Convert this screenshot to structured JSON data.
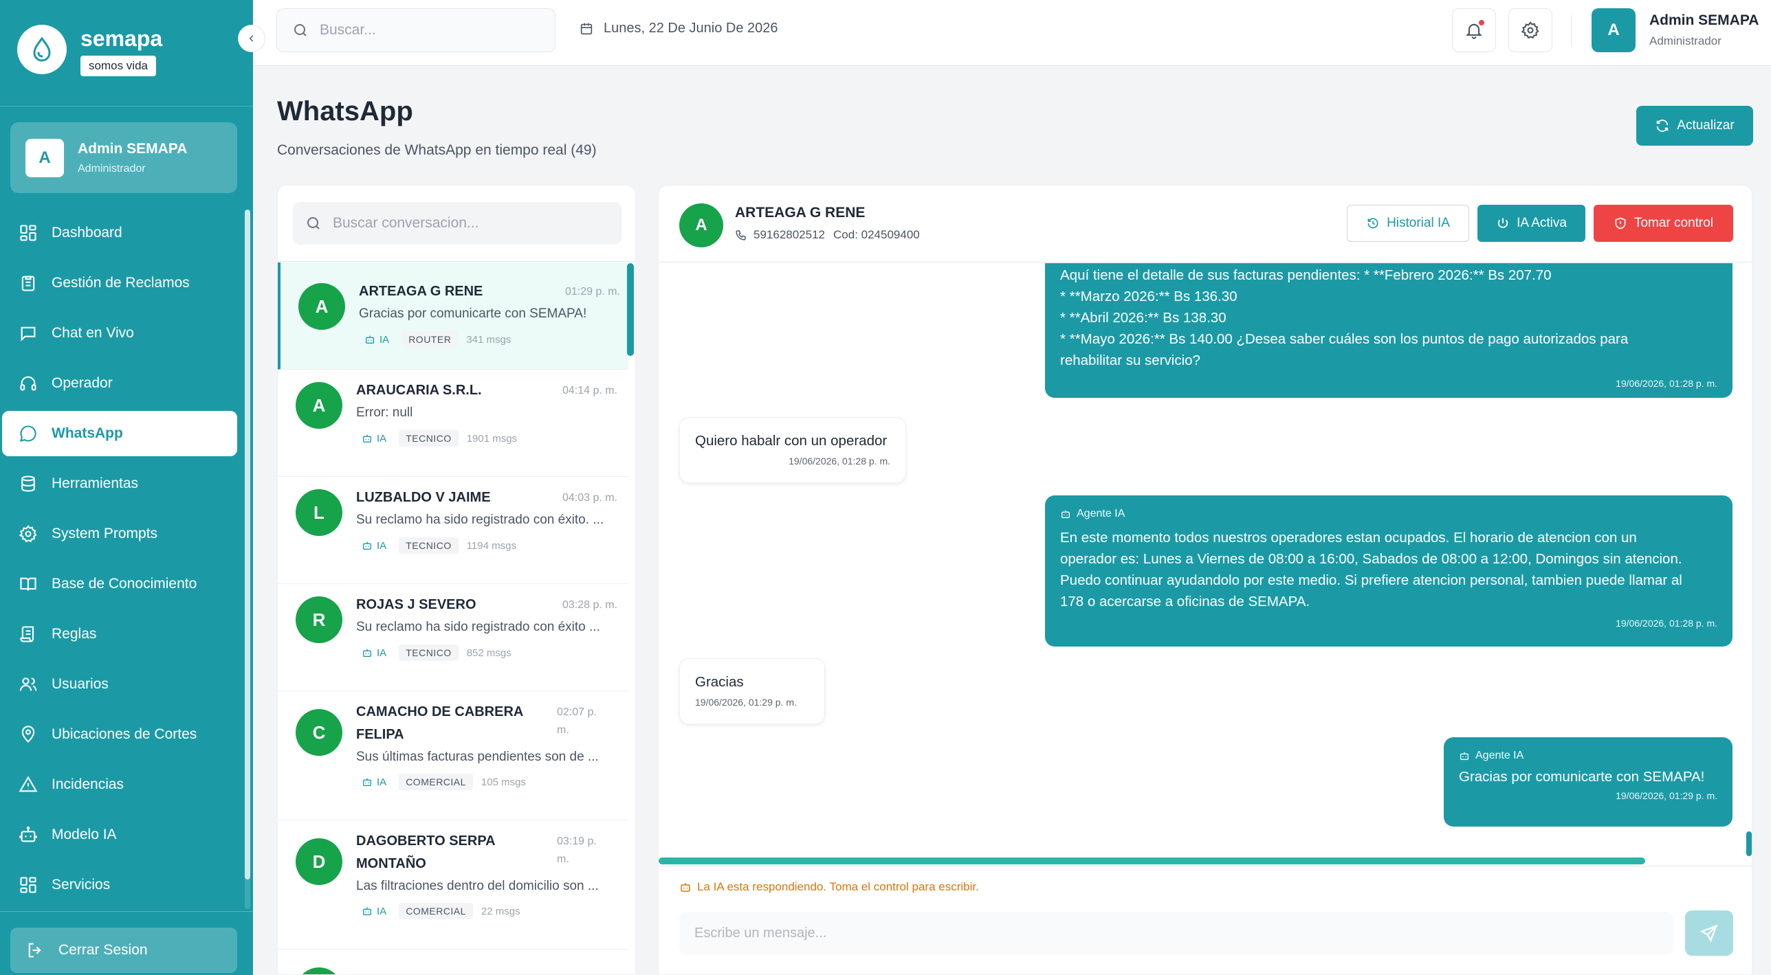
{
  "brand": {
    "name": "semapa",
    "tagline": "somos vida"
  },
  "sidebar_user": {
    "initial": "A",
    "name": "Admin SEMAPA",
    "role": "Administrador"
  },
  "nav": [
    {
      "label": "Dashboard",
      "icon": "dashboard-icon"
    },
    {
      "label": "Gestión de Reclamos",
      "icon": "clipboard-icon"
    },
    {
      "label": "Chat en Vivo",
      "icon": "chat-bubble-icon"
    },
    {
      "label": "Operador",
      "icon": "headphones-icon"
    },
    {
      "label": "WhatsApp",
      "icon": "whatsapp-icon",
      "active": true
    },
    {
      "label": "Herramientas",
      "icon": "database-icon"
    },
    {
      "label": "System Prompts",
      "icon": "gear-icon"
    },
    {
      "label": "Base de Conocimiento",
      "icon": "book-icon"
    },
    {
      "label": "Reglas",
      "icon": "scroll-icon"
    },
    {
      "label": "Usuarios",
      "icon": "users-icon"
    },
    {
      "label": "Ubicaciones de Cortes",
      "icon": "map-pin-icon"
    },
    {
      "label": "Incidencias",
      "icon": "warning-icon"
    },
    {
      "label": "Modelo IA",
      "icon": "robot-icon"
    },
    {
      "label": "Servicios",
      "icon": "grid-icon"
    }
  ],
  "logout_label": "Cerrar Sesion",
  "topbar": {
    "search_placeholder": "Buscar...",
    "date": "Lunes, 22 De Junio De 2026",
    "user_initial": "A",
    "user_name": "Admin SEMAPA",
    "user_role": "Administrador"
  },
  "page": {
    "title": "WhatsApp",
    "subtitle": "Conversaciones de WhatsApp en tiempo real (49)",
    "refresh_label": "Actualizar"
  },
  "conversation_search_placeholder": "Buscar conversacion...",
  "conversations": [
    {
      "initial": "A",
      "name": "ARTEAGA G RENE",
      "time": "01:29 p. m.",
      "preview": "Gracias por comunicarte con SEMAPA!",
      "ia": "IA",
      "category": "ROUTER",
      "count": "341 msgs"
    },
    {
      "initial": "A",
      "name": "ARAUCARIA S.R.L.",
      "time": "04:14 p. m.",
      "preview": "Error: null",
      "ia": "IA",
      "category": "TECNICO",
      "count": "1901 msgs"
    },
    {
      "initial": "L",
      "name": "LUZBALDO V JAIME",
      "time": "04:03 p. m.",
      "preview": "Su reclamo ha sido registrado con éxito. ...",
      "ia": "IA",
      "category": "TECNICO",
      "count": "1194 msgs"
    },
    {
      "initial": "R",
      "name": "ROJAS J SEVERO",
      "time": "03:28 p. m.",
      "preview": "Su reclamo ha sido registrado con éxito ...",
      "ia": "IA",
      "category": "TECNICO",
      "count": "852 msgs"
    },
    {
      "initial": "C",
      "name": "CAMACHO DE CABRERA FELIPA",
      "time": "02:07 p. m.",
      "preview": "Sus últimas facturas pendientes son de ...",
      "ia": "IA",
      "category": "COMERCIAL",
      "count": "105 msgs"
    },
    {
      "initial": "D",
      "name": "DAGOBERTO SERPA MONTAÑO",
      "time": "03:19 p. m.",
      "preview": "Las filtraciones dentro del domicilio son ...",
      "ia": "IA",
      "category": "COMERCIAL",
      "count": "22 msgs"
    }
  ],
  "chat": {
    "initial": "A",
    "name": "ARTEAGA G RENE",
    "phone": "59162802512",
    "code": "Cod: 024509400",
    "history_label": "Historial IA",
    "ia_active_label": "IA Activa",
    "take_control_label": "Tomar control",
    "messages": [
      {
        "direction": "out",
        "label": "",
        "lines": [
          "Aquí tiene el detalle de sus facturas pendientes: * **Febrero 2026:** Bs 207.70",
          "* **Marzo 2026:** Bs 136.30",
          "* **Abril 2026:** Bs 138.30",
          "* **Mayo 2026:** Bs 140.00 ¿Desea saber cuáles son los puntos de pago autorizados para",
          "rehabilitar su servicio?"
        ],
        "time": "19/06/2026, 01:28 p. m."
      },
      {
        "direction": "in",
        "lines": [
          "Quiero habalr con un operador"
        ],
        "time": "19/06/2026, 01:28 p. m."
      },
      {
        "direction": "out",
        "label": "Agente IA",
        "lines": [
          "En este momento todos nuestros operadores estan ocupados. El horario de atencion con un",
          "operador es: Lunes a Viernes de 08:00 a 16:00, Sabados de 08:00 a 12:00, Domingos sin atencion.",
          "Puedo continuar ayudandolo por este medio. Si prefiere atencion personal, tambien puede llamar al",
          "178 o acercarse a oficinas de SEMAPA."
        ],
        "time": "19/06/2026, 01:28 p. m."
      },
      {
        "direction": "in",
        "lines": [
          "Gracias"
        ],
        "time": "19/06/2026, 01:29 p. m."
      },
      {
        "direction": "out",
        "label": "Agente IA",
        "lines": [
          "Gracias por comunicarte con SEMAPA!"
        ],
        "time": "19/06/2026, 01:29 p. m."
      }
    ],
    "ia_notice": "La IA esta respondiendo. Toma el control para escribir.",
    "input_placeholder": "Escribe un mensaje..."
  },
  "colors": {
    "primary": "#1b9aa6",
    "danger": "#ef4444",
    "avatar_green": "#16a34a",
    "warning": "#d97706"
  }
}
